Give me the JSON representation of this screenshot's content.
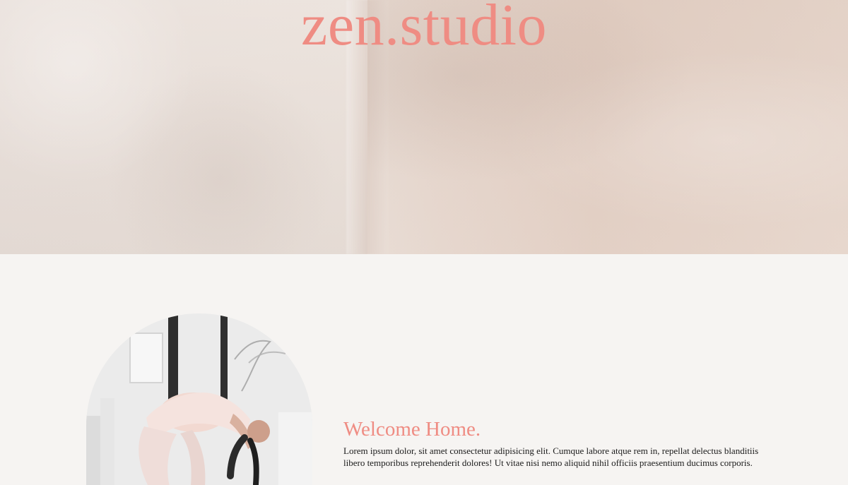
{
  "hero": {
    "brand": "zen.studio"
  },
  "intro": {
    "heading": "Welcome Home.",
    "body": "Lorem ipsum dolor, sit amet consectetur adipisicing elit. Cumque labore atque rem in, repellat delectus blanditiis libero temporibus reprehenderit dolores! Ut vitae nisi nemo aliquid nihil officiis praesentium ducimus corporis."
  },
  "colors": {
    "accent": "#ef8c83",
    "page_background": "#f6f4f2",
    "hero_stone": "#e4d3c9",
    "body_text": "#1b1b1b"
  }
}
